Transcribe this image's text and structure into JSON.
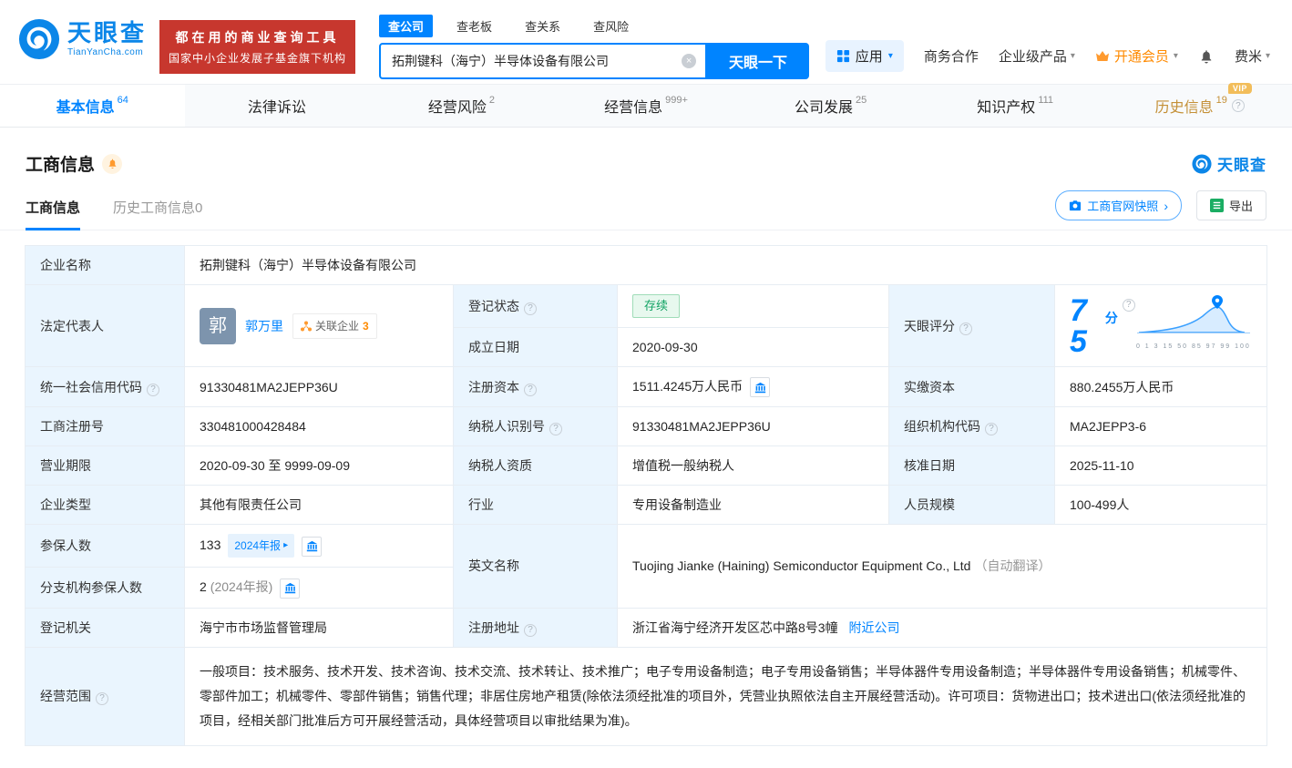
{
  "header": {
    "logo": {
      "brand": "天眼查",
      "domain": "TianYanCha.com"
    },
    "banner": {
      "line1": "都在用的商业查询工具",
      "line2": "国家中小企业发展子基金旗下机构"
    },
    "search_tabs": [
      {
        "label": "查公司"
      },
      {
        "label": "查老板"
      },
      {
        "label": "查关系"
      },
      {
        "label": "查风险"
      }
    ],
    "search": {
      "value": "拓荆键科（海宁）半导体设备有限公司",
      "button": "天眼一下"
    },
    "right": {
      "apps": "应用",
      "cooperation": "商务合作",
      "enterprise": "企业级产品",
      "vip": "开通会员",
      "user": "费米"
    }
  },
  "nav_tabs": [
    {
      "label": "基本信息",
      "count": "64"
    },
    {
      "label": "法律诉讼",
      "count": ""
    },
    {
      "label": "经营风险",
      "count": "2"
    },
    {
      "label": "经营信息",
      "count": "999+"
    },
    {
      "label": "公司发展",
      "count": "25"
    },
    {
      "label": "知识产权",
      "count": "111"
    },
    {
      "label": "历史信息",
      "count": "19",
      "vip": "VIP"
    }
  ],
  "section": {
    "title": "工商信息",
    "brand": "天眼查",
    "subtabs": [
      {
        "label": "工商信息"
      },
      {
        "label": "历史工商信息0"
      }
    ],
    "snapshot_button": "工商官网快照",
    "export_button": "导出"
  },
  "info": {
    "company_name": {
      "label": "企业名称",
      "value": "拓荆键科（海宁）半导体设备有限公司"
    },
    "legal_rep": {
      "label": "法定代表人",
      "avatar": "郭",
      "name": "郭万里",
      "related_label": "关联企业",
      "related_count": "3"
    },
    "reg_status": {
      "label": "登记状态",
      "value": "存续"
    },
    "established": {
      "label": "成立日期",
      "value": "2020-09-30"
    },
    "score": {
      "label": "天眼评分",
      "value": "75",
      "unit": "分",
      "axis": "0 1 3 15 50 85 97 99 100"
    },
    "credit_code": {
      "label": "统一社会信用代码",
      "value": "91330481MA2JEPP36U"
    },
    "reg_capital": {
      "label": "注册资本",
      "value": "1511.4245万人民币"
    },
    "paid_capital": {
      "label": "实缴资本",
      "value": "880.2455万人民币"
    },
    "reg_no": {
      "label": "工商注册号",
      "value": "330481000428484"
    },
    "taxpayer_id": {
      "label": "纳税人识别号",
      "value": "91330481MA2JEPP36U"
    },
    "org_code": {
      "label": "组织机构代码",
      "value": "MA2JEPP3-6"
    },
    "term": {
      "label": "营业期限",
      "value": "2020-09-30 至 9999-09-09"
    },
    "taxpayer_quality": {
      "label": "纳税人资质",
      "value": "增值税一般纳税人"
    },
    "approval_date": {
      "label": "核准日期",
      "value": "2025-11-10"
    },
    "company_type": {
      "label": "企业类型",
      "value": "其他有限责任公司"
    },
    "industry": {
      "label": "行业",
      "value": "专用设备制造业"
    },
    "staff": {
      "label": "人员规模",
      "value": "100-499人"
    },
    "insured": {
      "label": "参保人数",
      "value": "133",
      "report": "2024年报"
    },
    "english_name": {
      "label": "英文名称",
      "value": "Tuojing Jianke (Haining) Semiconductor Equipment Co., Ltd",
      "note": "（自动翻译）"
    },
    "branch_insured": {
      "label": "分支机构参保人数",
      "value": "2",
      "report": "(2024年报)"
    },
    "authority": {
      "label": "登记机关",
      "value": "海宁市市场监督管理局"
    },
    "address": {
      "label": "注册地址",
      "value": "浙江省海宁经济开发区芯中路8号3幢",
      "nearby": "附近公司"
    },
    "scope": {
      "label": "经营范围",
      "value": "一般项目：技术服务、技术开发、技术咨询、技术交流、技术转让、技术推广；电子专用设备制造；电子专用设备销售；半导体器件专用设备制造；半导体器件专用设备销售；机械零件、零部件加工；机械零件、零部件销售；销售代理；非居住房地产租赁(除依法须经批准的项目外，凭营业执照依法自主开展经营活动)。许可项目：货物进出口；技术进出口(依法须经批准的项目，经相关部门批准后方可开展经营活动，具体经营项目以审批结果为准)。"
    }
  },
  "icons": {
    "help": "?",
    "clear": "×",
    "caret": "▾",
    "arrow_right": "›",
    "report_arrow": "▸"
  },
  "colors": {
    "accent": "#0084ff",
    "vip_orange": "#ff8a00",
    "status_green": "#12a364",
    "banner_red": "#c7372e"
  }
}
